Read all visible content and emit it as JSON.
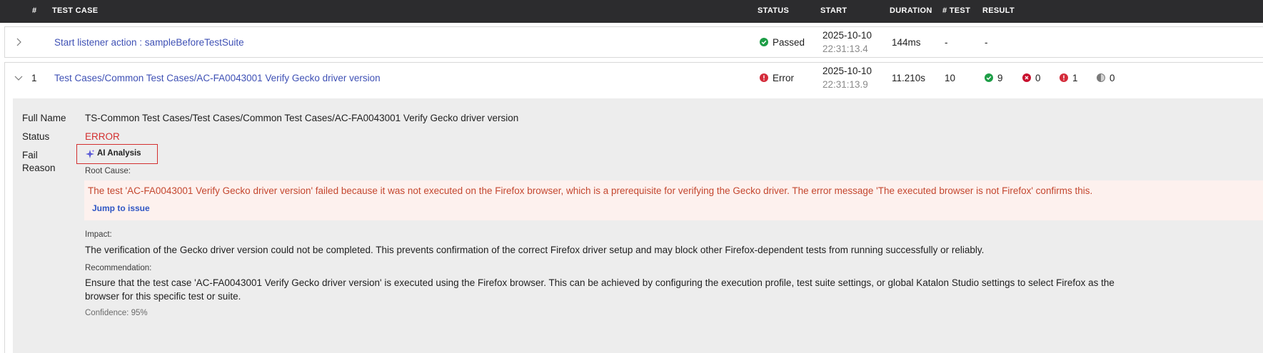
{
  "header": {
    "num": "#",
    "test_case": "TEST CASE",
    "status": "STATUS",
    "start": "START",
    "duration": "DURATION",
    "num_test": "# TEST",
    "result": "RESULT"
  },
  "rows": [
    {
      "index": "",
      "name": "Start listener action : sampleBeforeTestSuite",
      "status": "Passed",
      "start_date": "2025-10-10",
      "start_time": "22:31:13.4",
      "duration": "144ms",
      "num_test": "-",
      "result": "-",
      "expanded": false
    },
    {
      "index": "1",
      "name": "Test Cases/Common Test Cases/AC-FA0043001 Verify Gecko driver version",
      "status": "Error",
      "start_date": "2025-10-10",
      "start_time": "22:31:13.9",
      "duration": "11.210s",
      "num_test": "10",
      "result_counts": {
        "passed": "9",
        "failed": "0",
        "error": "1",
        "skipped": "0"
      },
      "expanded": true
    }
  ],
  "detail": {
    "full_name_label": "Full Name",
    "full_name": "TS-Common Test Cases/Test Cases/Common Test Cases/AC-FA0043001 Verify Gecko driver version",
    "status_label": "Status",
    "status": "ERROR",
    "fail_reason_label_1": "Fail",
    "fail_reason_label_2": "Reason",
    "ai_button": "AI Analysis",
    "root_cause_label": "Root Cause:",
    "root_cause": "The test 'AC-FA0043001 Verify Gecko driver version' failed because it was not executed on the Firefox browser, which is a prerequisite for verifying the Gecko driver. The error message 'The executed browser is not Firefox' confirms this.",
    "jump_link": "Jump to issue",
    "impact_label": "Impact:",
    "impact": "The verification of the Gecko driver version could not be completed. This prevents confirmation of the correct Firefox driver setup and may block other Firefox-dependent tests from running successfully or reliably.",
    "recommendation_label": "Recommendation:",
    "recommendation_line1": "Ensure that the test case 'AC-FA0043001 Verify Gecko driver version' is executed using the Firefox browser. This can be achieved by configuring the execution profile, test suite settings, or global Katalon Studio settings to select Firefox as the",
    "recommendation_line2": "browser for this specific test or suite.",
    "confidence": "Confidence: 95%"
  },
  "colors": {
    "header_bg": "#2c2c2e",
    "link": "#3f51b5",
    "passed": "#1e9e47",
    "error": "#d42b3a",
    "error_text": "#d32f2f",
    "root_cause_bg": "#fdf1ee",
    "root_cause_text": "#c4472f",
    "detail_bg": "#ededed"
  },
  "icons": [
    "chevron-right-icon",
    "chevron-down-icon",
    "check-circle-icon",
    "error-circle-icon",
    "x-circle-icon",
    "half-circle-icon",
    "sparkle-icon"
  ]
}
